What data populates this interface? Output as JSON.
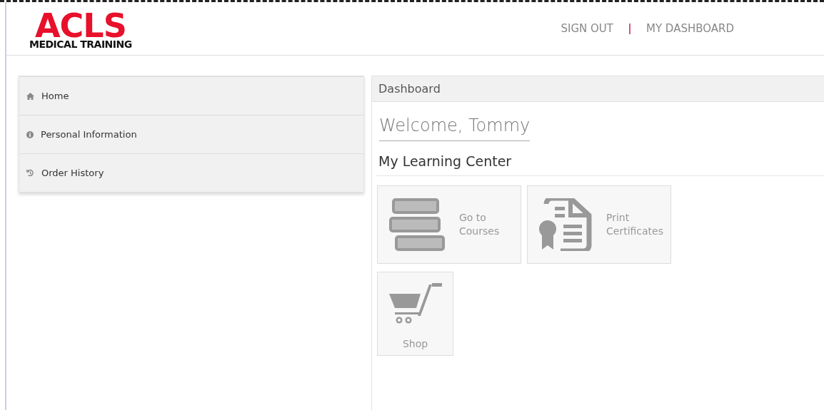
{
  "logo": {
    "title": "ACLS",
    "subtitle": "MEDICAL TRAINING"
  },
  "top_nav": [
    {
      "label": "SIGN OUT"
    },
    {
      "label": "MY DASHBOARD"
    }
  ],
  "sidebar": {
    "items": [
      {
        "label": "Home",
        "kind": "home"
      },
      {
        "label": "Personal Information",
        "kind": "info"
      },
      {
        "label": "Order History",
        "kind": "history"
      }
    ]
  },
  "panel": {
    "title": "Dashboard",
    "welcome": "Welcome, Tommy",
    "section_title": "My Learning Center",
    "tiles": [
      {
        "kind": "books",
        "lines": [
          "Go to",
          "Courses"
        ]
      },
      {
        "kind": "certificate",
        "lines": [
          "Print",
          "Certificates"
        ]
      },
      {
        "kind": "cart",
        "lines": [
          "Shop"
        ]
      }
    ]
  }
}
